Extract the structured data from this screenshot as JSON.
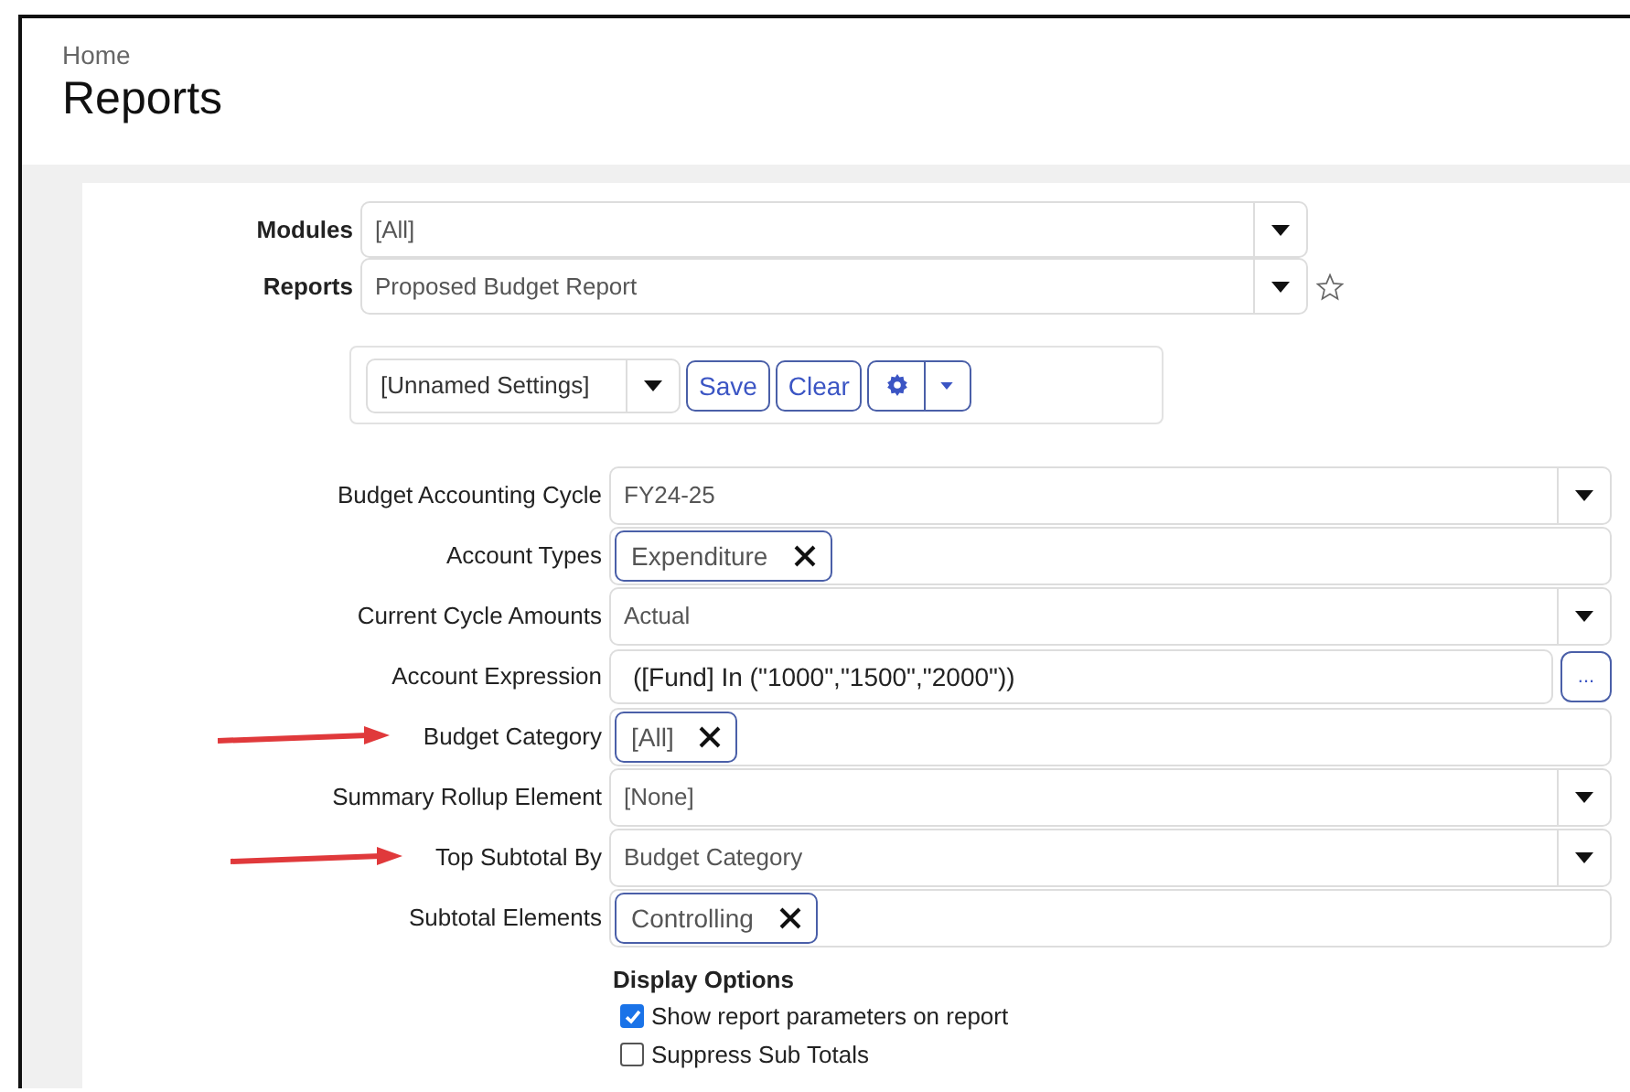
{
  "breadcrumb": "Home",
  "title": "Reports",
  "top_fields": [
    {
      "label": "Modules",
      "value": "[All]",
      "star": false
    },
    {
      "label": "Reports",
      "value": "Proposed Budget Report",
      "star": true
    }
  ],
  "settings": {
    "value": "[Unnamed Settings]",
    "buttons": [
      "Save",
      "Clear"
    ]
  },
  "parameters": [
    {
      "label": "Budget Accounting Cycle",
      "kind": "select",
      "value": "FY24-25",
      "highlighted": false
    },
    {
      "label": "Account Types",
      "kind": "tags",
      "tags": [
        "Expenditure"
      ],
      "highlighted": false
    },
    {
      "label": "Current Cycle Amounts",
      "kind": "select",
      "value": "Actual",
      "highlighted": false
    },
    {
      "label": "Account Expression",
      "kind": "expression",
      "value": "([Fund] In (\"1000\",\"1500\",\"2000\"))",
      "button": "...",
      "highlighted": false
    },
    {
      "label": "Budget Category",
      "kind": "tags",
      "tags": [
        "[All]"
      ],
      "highlighted": true
    },
    {
      "label": "Summary Rollup Element",
      "kind": "select",
      "value": "[None]",
      "highlighted": false
    },
    {
      "label": "Top Subtotal By",
      "kind": "select",
      "value": "Budget Category",
      "highlighted": true
    },
    {
      "label": "Subtotal Elements",
      "kind": "tags",
      "tags": [
        "Controlling"
      ],
      "highlighted": false
    }
  ],
  "display_options": {
    "title": "Display Options",
    "options": [
      {
        "label": "Show report parameters on report",
        "checked": true
      },
      {
        "label": "Suppress Sub Totals",
        "checked": false
      }
    ]
  }
}
